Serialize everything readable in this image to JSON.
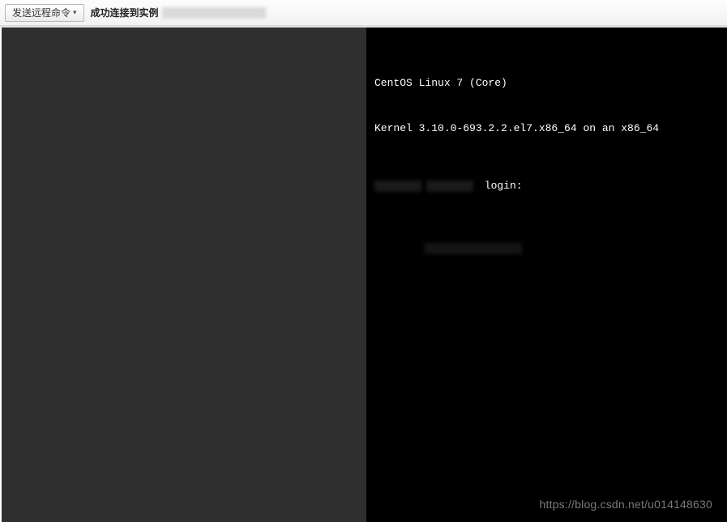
{
  "toolbar": {
    "send_command_label": "发送远程命令",
    "status_prefix": "成功连接到实例"
  },
  "terminal": {
    "os_line": "CentOS Linux 7 (Core)",
    "kernel_line": "Kernel 3.10.0-693.2.2.el7.x86_64 on an x86_64",
    "login_suffix": " login:"
  },
  "watermark": "https://blog.csdn.net/u014148630"
}
